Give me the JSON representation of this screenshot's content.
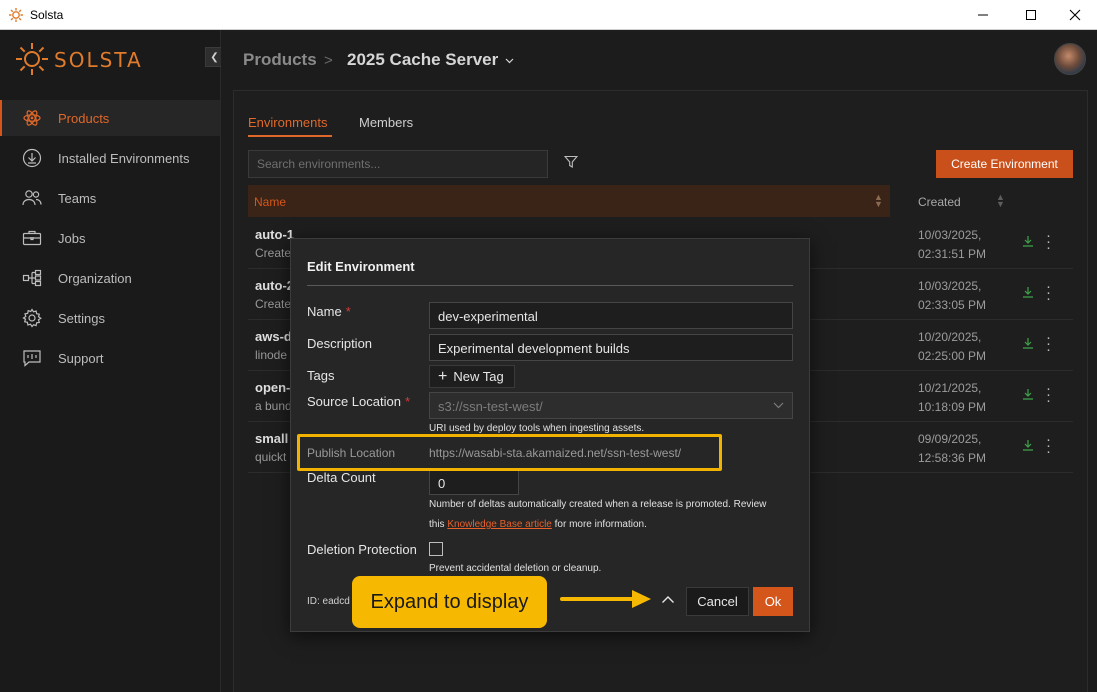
{
  "window": {
    "title": "Solsta"
  },
  "brand": {
    "name": "SOLSTA",
    "accent": "#e0682a"
  },
  "sidebar": {
    "items": [
      {
        "label": "Products",
        "icon": "atom-icon",
        "active": true
      },
      {
        "label": "Installed Environments",
        "icon": "download-icon",
        "active": false
      },
      {
        "label": "Teams",
        "icon": "users-icon",
        "active": false
      },
      {
        "label": "Jobs",
        "icon": "briefcase-icon",
        "active": false
      },
      {
        "label": "Organization",
        "icon": "hierarchy-icon",
        "active": false
      },
      {
        "label": "Settings",
        "icon": "gear-icon",
        "active": false
      },
      {
        "label": "Support",
        "icon": "chat-icon",
        "active": false
      }
    ]
  },
  "header": {
    "breadcrumb_root": "Products",
    "breadcrumb_sep": ">",
    "product_name": "2025 Cache Server"
  },
  "tabs": [
    {
      "label": "Environments",
      "active": true
    },
    {
      "label": "Members",
      "active": false
    }
  ],
  "search": {
    "placeholder": "Search environments..."
  },
  "create_button": "Create Environment",
  "table": {
    "col_name": "Name",
    "col_created": "Created",
    "rows": [
      {
        "name": "auto-1",
        "desc": "Create",
        "created_date": "10/03/2025,",
        "created_time": "02:31:51 PM"
      },
      {
        "name": "auto-2",
        "desc": "Create",
        "created_date": "10/03/2025,",
        "created_time": "02:33:05 PM"
      },
      {
        "name": "aws-d",
        "desc": "linode",
        "created_date": "10/20/2025,",
        "created_time": "02:25:00 PM"
      },
      {
        "name": "open-",
        "desc": "a bund",
        "created_date": "10/21/2025,",
        "created_time": "10:18:09 PM"
      },
      {
        "name": "small",
        "desc": "quickt",
        "created_date": "09/09/2025,",
        "created_time": "12:58:36 PM"
      }
    ]
  },
  "modal": {
    "title": "Edit Environment",
    "name_label": "Name",
    "name_value": "dev-experimental",
    "desc_label": "Description",
    "desc_value": "Experimental development builds",
    "tags_label": "Tags",
    "new_tag": "New Tag",
    "source_label": "Source Location",
    "source_value": "s3://ssn-test-west/",
    "source_help": "URI used by deploy tools when ingesting assets.",
    "publish_label": "Publish Location",
    "publish_value": "https://wasabi-sta.akamaized.net/ssn-test-west/",
    "delta_label": "Delta Count",
    "delta_value": "0",
    "delta_help_1": "Number of deltas automatically created when a release is promoted. Review",
    "delta_help_2a": "this",
    "delta_help_link": "Knowledge Base article",
    "delta_help_2b": "for more information.",
    "deletion_label": "Deletion Protection",
    "deletion_checked": false,
    "deletion_help": "Prevent accidental deletion or cleanup.",
    "id_label": "ID: eadcd",
    "cancel": "Cancel",
    "ok": "Ok"
  },
  "annotation": {
    "callout": "Expand to display",
    "color": "#f6b800"
  }
}
